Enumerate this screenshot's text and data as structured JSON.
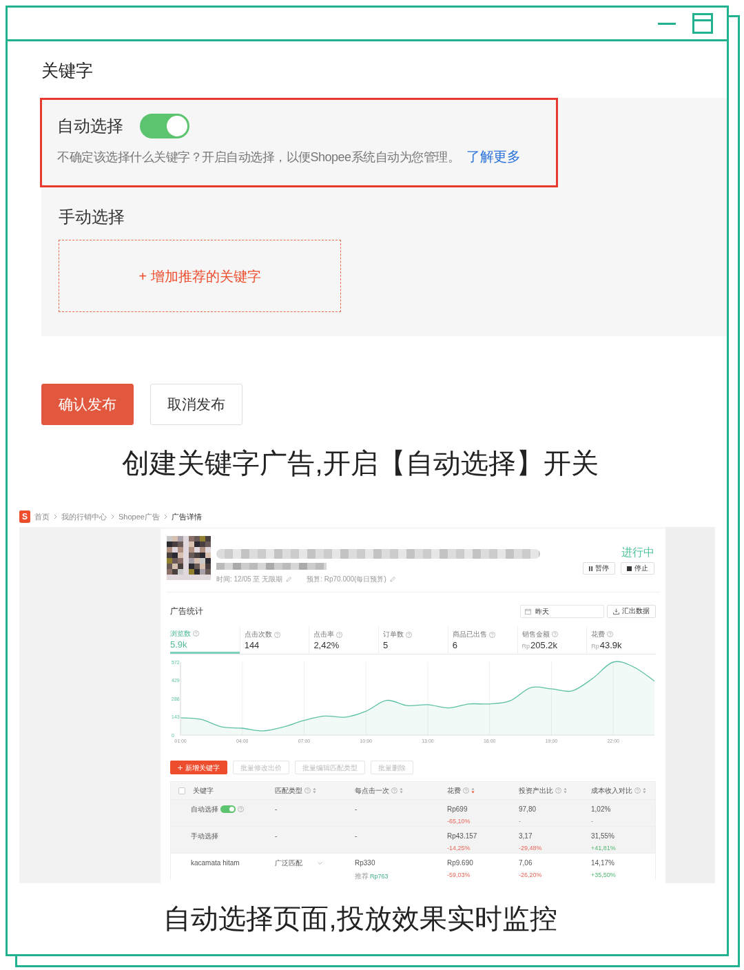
{
  "keyword_section": {
    "title": "关键字",
    "auto_select": {
      "label": "自动选择",
      "on": true,
      "description": "不确定该选择什么关键字？开启自动选择，以便Shopee系统自动为您管理。",
      "link": "了解更多"
    },
    "manual_select": {
      "label": "手动选择",
      "add_button": "+ 增加推荐的关键字"
    },
    "buttons": [
      {
        "label": "确认发布",
        "kind": "primary"
      },
      {
        "label": "取消发布",
        "kind": "secondary"
      }
    ]
  },
  "caption_1": "创建关键字广告,开启【自动选择】开关",
  "screenshot": {
    "logo": "S",
    "breadcrumb": [
      {
        "label": "首页",
        "current": false
      },
      {
        "label": "我的行销中心",
        "current": false
      },
      {
        "label": "Shopee广告",
        "current": false
      },
      {
        "label": "广告详情",
        "current": true
      }
    ],
    "ad": {
      "status": "进行中",
      "time": "时间: 12/05 至 无限期",
      "budget": "预算: Rp70.000(每日预算)",
      "actions": [
        {
          "label": "暂停",
          "kind": "pause"
        },
        {
          "label": "停止",
          "kind": "stop"
        }
      ]
    },
    "stats": {
      "title": "广告统计",
      "date": "昨天",
      "export": "汇出数据",
      "metrics": [
        {
          "label": "浏览数",
          "value": "5.9k",
          "selected": true
        },
        {
          "label": "点击次数",
          "value": "144",
          "selected": false
        },
        {
          "label": "点击率",
          "value": "2,42%",
          "selected": false
        },
        {
          "label": "订单数",
          "value": "5",
          "selected": false
        },
        {
          "label": "商品已出售",
          "value": "6",
          "selected": false
        },
        {
          "label": "销售金额",
          "prefix": "Rp",
          "value": "205.2k",
          "selected": false
        },
        {
          "label": "花费",
          "prefix": "Rp",
          "value": "43.9k",
          "selected": false
        }
      ],
      "chart_data": {
        "type": "area",
        "x": [
          1,
          2,
          3,
          4,
          5,
          6,
          7,
          8,
          9,
          10,
          11,
          12,
          13,
          14,
          15,
          16,
          17,
          18,
          19,
          20,
          21,
          22,
          23,
          24
        ],
        "grid": true,
        "series": [
          {
            "color": "#5bc0a5",
            "values": [
              136,
              123,
              64,
              54,
              33,
              64,
              115,
              149,
              141,
              187,
              272,
              231,
              238,
              213,
              244,
              244,
              269,
              372,
              362,
              346,
              444,
              572,
              533,
              423
            ]
          }
        ],
        "xlim": [
          1,
          24
        ],
        "ylim": [
          0,
          572
        ],
        "xticks": [
          {
            "value": 1,
            "label": "01:00"
          },
          {
            "value": 4,
            "label": "04:00"
          },
          {
            "value": 7,
            "label": "07:00"
          },
          {
            "value": 10,
            "label": "10:00"
          },
          {
            "value": 13,
            "label": "13:00"
          },
          {
            "value": 16,
            "label": "16:00"
          },
          {
            "value": 19,
            "label": "19:00"
          },
          {
            "value": 22,
            "label": "22:00"
          }
        ],
        "yticks": [
          0,
          143,
          286,
          429,
          572
        ]
      }
    },
    "toolbar": [
      {
        "label": "新增关键字",
        "kind": "primary",
        "disabled": false
      },
      {
        "label": "批量修改出价",
        "kind": "default",
        "disabled": true
      },
      {
        "label": "批量编辑匹配类型",
        "kind": "default",
        "disabled": true
      },
      {
        "label": "批量删除",
        "kind": "default",
        "disabled": true
      }
    ],
    "table": {
      "select_all": {
        "checked": false
      },
      "columns": [
        {
          "label": "关键字",
          "help": false,
          "sortable": false
        },
        {
          "label": "匹配类型",
          "help": true,
          "sortable": true,
          "sorted": false
        },
        {
          "label": "每点击一次",
          "help": true,
          "sortable": true,
          "sorted": false
        },
        {
          "label": "花费",
          "help": true,
          "sortable": true,
          "sorted": true
        },
        {
          "label": "投资产出比",
          "help": true,
          "sortable": true,
          "sorted": false
        },
        {
          "label": "成本收入对比",
          "help": true,
          "sortable": true,
          "sorted": false
        }
      ],
      "rows": [
        {
          "kind": "group",
          "cells": [
            {
              "text": "自动选择",
              "toggle": {
                "on": true
              },
              "help": true
            },
            {
              "text": "-"
            },
            {
              "text": "-"
            },
            {
              "text": "Rp699",
              "sub": {
                "text": "-65,10%",
                "kind": "negative"
              }
            },
            {
              "text": "97,80",
              "sub": {
                "text": "-",
                "kind": "neutral"
              }
            },
            {
              "text": "1,02%",
              "sub": {
                "text": "-",
                "kind": "neutral"
              }
            }
          ]
        },
        {
          "kind": "group",
          "cells": [
            {
              "text": "手动选择"
            },
            {
              "text": "-"
            },
            {
              "text": "-"
            },
            {
              "text": "Rp43.157",
              "sub": {
                "text": "-14,25%",
                "kind": "negative"
              }
            },
            {
              "text": "3,17",
              "sub": {
                "text": "-29,48%",
                "kind": "negative"
              }
            },
            {
              "text": "31,55%",
              "sub": {
                "text": "+41,81%",
                "kind": "positive"
              }
            }
          ]
        },
        {
          "kind": "keyword",
          "cells": [
            {
              "text": "kacamata hitam"
            },
            {
              "text": "广泛匹配",
              "dropdown": true
            },
            {
              "text": "Rp330",
              "note": "推荐",
              "sub": {
                "text": "Rp763",
                "kind": "recommended"
              }
            },
            {
              "text": "Rp9.690",
              "sub": {
                "text": "-59,03%",
                "kind": "negative"
              }
            },
            {
              "text": "7,06",
              "sub": {
                "text": "-26,20%",
                "kind": "negative"
              }
            },
            {
              "text": "14,17%",
              "sub": {
                "text": "+35,50%",
                "kind": "positive"
              }
            }
          ]
        }
      ]
    }
  },
  "caption_2": "自动选择页面,投放效果实时监控"
}
